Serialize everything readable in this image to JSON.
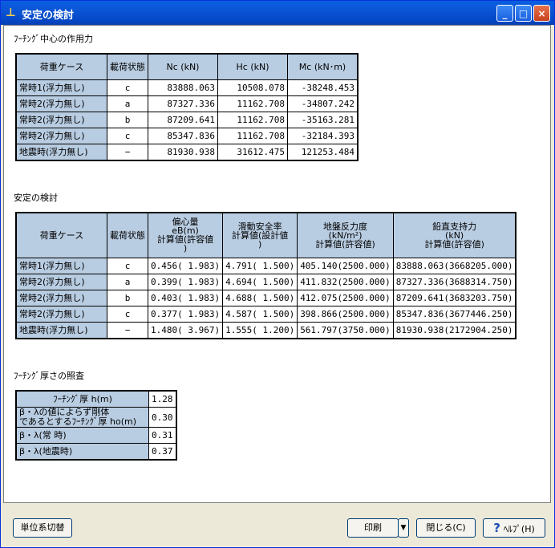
{
  "window": {
    "title": "安定の検討",
    "min": "_",
    "max": "□",
    "close": "×"
  },
  "section1": {
    "title": "ﾌｰﾁﾝｸﾞ中心の作用力",
    "headers": [
      "荷重ケース",
      "載荷状態",
      "Nc (kN)",
      "Hc (kN)",
      "Mc (kN･m)"
    ],
    "rows": [
      [
        "常時1(浮力無し)",
        "c",
        "83888.063",
        "10508.078",
        "-38248.453"
      ],
      [
        "常時2(浮力無し)",
        "a",
        "87327.336",
        "11162.708",
        "-34807.242"
      ],
      [
        "常時2(浮力無し)",
        "b",
        "87209.641",
        "11162.708",
        "-35163.281"
      ],
      [
        "常時2(浮力無し)",
        "c",
        "85347.836",
        "11162.708",
        "-32184.393"
      ],
      [
        "地震時(浮力無し)",
        "−",
        "81930.938",
        "31612.475",
        "121253.484"
      ]
    ]
  },
  "section2": {
    "title": "安定の検討",
    "headers": [
      "荷重ケース",
      "載荷状態",
      "偏心量\neB(m)\n計算値(許容値\n)",
      "滑動安全率\n計算値(設計値\n)",
      "地盤反力度\n(kN/m²)\n計算値(許容値)",
      "鉛直支持力\n(kN)\n計算値(許容値)"
    ],
    "rows": [
      [
        "常時1(浮力無し)",
        "c",
        "0.456( 1.983)",
        "4.791( 1.500)",
        "405.140(2500.000)",
        "83888.063(3668205.000)"
      ],
      [
        "常時2(浮力無し)",
        "a",
        "0.399( 1.983)",
        "4.694( 1.500)",
        "411.832(2500.000)",
        "87327.336(3688314.750)"
      ],
      [
        "常時2(浮力無し)",
        "b",
        "0.403( 1.983)",
        "4.688( 1.500)",
        "412.075(2500.000)",
        "87209.641(3683203.750)"
      ],
      [
        "常時2(浮力無し)",
        "c",
        "0.377( 1.983)",
        "4.587( 1.500)",
        "398.866(2500.000)",
        "85347.836(3677446.250)"
      ],
      [
        "地震時(浮力無し)",
        "−",
        "1.480( 3.967)",
        "1.555( 1.200)",
        "561.797(3750.000)",
        "81930.938(2172904.250)"
      ]
    ]
  },
  "section3": {
    "title": "ﾌｰﾁﾝｸﾞ厚さの照査",
    "rows": [
      [
        "ﾌｰﾁﾝｸﾞ厚 h(m)",
        "1.28"
      ],
      [
        "β・λの値によらず剛体\nであるとするﾌｰﾁﾝｸﾞ厚 ho(m)",
        "0.30"
      ],
      [
        "β・λ(常 時)",
        "0.31"
      ],
      [
        "β・λ(地震時)",
        "0.37"
      ]
    ]
  },
  "footer": {
    "unit_switch": "単位系切替",
    "print": "印刷",
    "print_arrow": "▼",
    "close": "閉じる(C)",
    "help_icon": "?",
    "help": "ﾍﾙﾌﾟ(H)"
  }
}
